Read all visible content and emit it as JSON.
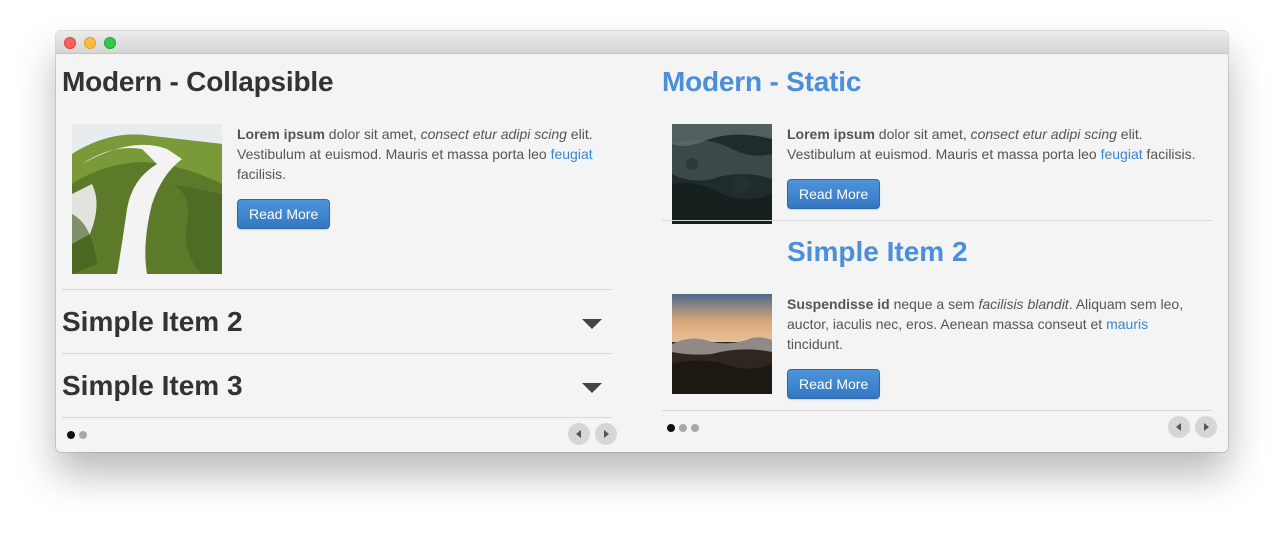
{
  "window": {
    "controls": [
      "close",
      "minimize",
      "maximize"
    ]
  },
  "left": {
    "title": "Modern - Collapsible",
    "item1": {
      "bold": "Lorem ipsum",
      "text_a": " dolor sit amet, ",
      "italic": "consect etur adipi scing",
      "text_b": " elit. Vestibulum at euismod. Mauris et massa porta leo ",
      "link": "feugiat",
      "text_c": " facilisis.",
      "button": "Read More"
    },
    "collapsed_items": [
      {
        "label": "Simple Item 2"
      },
      {
        "label": "Simple Item 3"
      }
    ],
    "pager": {
      "pages": 2,
      "active": 1
    }
  },
  "right": {
    "title": "Modern - Static",
    "item1": {
      "bold": "Lorem ipsum",
      "text_a": " dolor sit amet, ",
      "italic": "consect etur adipi scing",
      "text_b": " elit. Vestibulum at euismod. Mauris et massa porta leo ",
      "link": "feugiat",
      "text_c": " facilisis.",
      "button": "Read More"
    },
    "item2": {
      "title": "Simple Item 2",
      "bold": "Suspendisse id",
      "text_a": " neque a sem ",
      "italic": "facilisis blandit",
      "text_b": ". Aliquam sem leo, auctor, iaculis nec, eros. Aenean massa conseut et ",
      "link": "mauris",
      "text_c": " tincidunt.",
      "button": "Read More"
    },
    "pager": {
      "pages": 3,
      "active": 1
    }
  },
  "colors": {
    "accent": "#4a8fd8",
    "button": "#3a7fcb",
    "link": "#3a87d1",
    "window_bg": "#f4f4f4"
  },
  "icons": [
    "close-light",
    "minimize-light",
    "maximize-light",
    "caret-down-icon",
    "arrow-left-icon",
    "arrow-right-icon"
  ]
}
